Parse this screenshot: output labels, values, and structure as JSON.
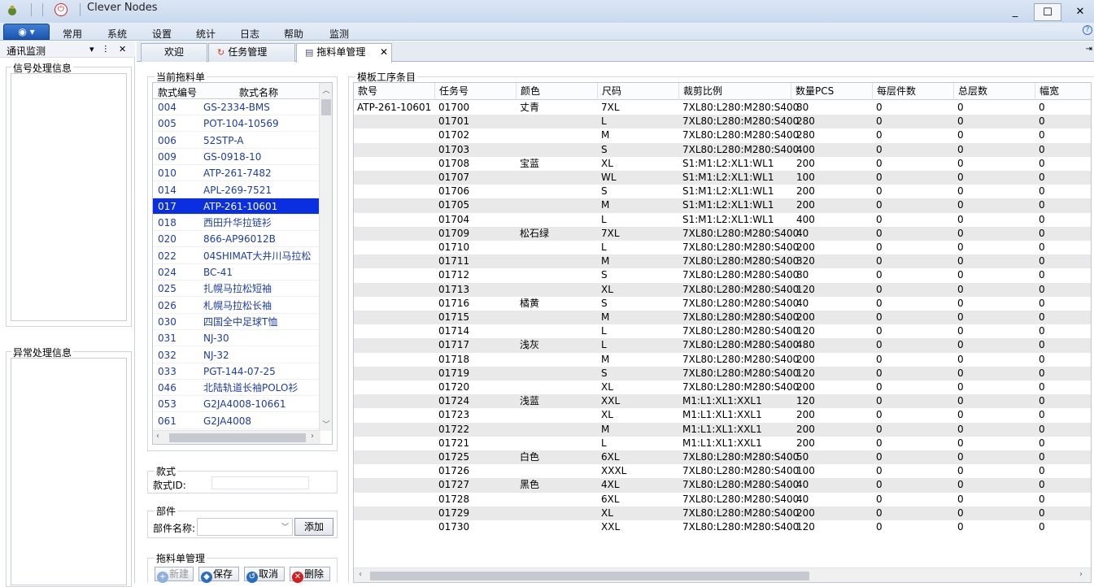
{
  "window": {
    "title": "Clever Nodes",
    "minimize": "_",
    "maximize": "☐",
    "close": "✕"
  },
  "menu": {
    "app_button": "◉ ▾",
    "items": [
      "常用",
      "系统",
      "设置",
      "统计",
      "日志",
      "帮助",
      "监测"
    ],
    "help_icon": "?"
  },
  "left_panel": {
    "title": "通讯监测",
    "pin": "▾ ⊓ ✕",
    "group1": "信号处理信息",
    "group2": "异常处理信息"
  },
  "tabs": [
    {
      "label": "欢迎",
      "icon": ""
    },
    {
      "label": "任务管理",
      "icon": "↻"
    },
    {
      "label": "拖料单管理",
      "icon": "▤",
      "close": "✕"
    }
  ],
  "current_sheet": {
    "label": "当前拖料单",
    "headers": [
      "款式编号",
      "款式名称"
    ],
    "rows": [
      [
        "004",
        "GS-2334-BMS"
      ],
      [
        "005",
        "POT-104-10569"
      ],
      [
        "006",
        "52STP-A"
      ],
      [
        "009",
        "GS-0918-10"
      ],
      [
        "010",
        "ATP-261-7482"
      ],
      [
        "014",
        "APL-269-7521"
      ],
      [
        "017",
        "ATP-261-10601"
      ],
      [
        "018",
        "西田升华拉链衫"
      ],
      [
        "020",
        "866-AP96012B"
      ],
      [
        "022",
        "04SHIMAT大井川马拉松"
      ],
      [
        "024",
        "BC-41"
      ],
      [
        "025",
        "扎幌马拉松短袖"
      ],
      [
        "026",
        "札幌马拉松长袖"
      ],
      [
        "030",
        "四国全中足球T恤"
      ],
      [
        "031",
        "NJ-30"
      ],
      [
        "032",
        "NJ-32"
      ],
      [
        "033",
        "PGT-144-07-25"
      ],
      [
        "046",
        "北陆轨道长袖POLO衫"
      ],
      [
        "053",
        "G2JA4008-10661"
      ],
      [
        "061",
        "G2JA4008"
      ]
    ],
    "selected_index": 6
  },
  "style_box": {
    "label": "款式",
    "id_label": "款式ID:",
    "id_value": ""
  },
  "part_box": {
    "label": "部件",
    "name_label": "部件名称:",
    "name_value": "",
    "add_button": "添加"
  },
  "sheet_mgmt": {
    "label": "拖料单管理",
    "new": "新建",
    "save": "保存",
    "cancel": "取消",
    "delete": "删除"
  },
  "template": {
    "label": "模板工序条目",
    "headers": [
      "款号",
      "任务号",
      "颜色",
      "尺码",
      "裁剪比例",
      "数量PCS",
      "每层件数",
      "总层数",
      "幅宽"
    ],
    "rows": [
      [
        "ATP-261-10601",
        "01700",
        "丈青",
        "7XL",
        "7XL80:L280:M280:S400",
        "80",
        "0",
        "0",
        "0"
      ],
      [
        "",
        "01701",
        "",
        "L",
        "7XL80:L280:M280:S400",
        "280",
        "0",
        "0",
        "0"
      ],
      [
        "",
        "01702",
        "",
        "M",
        "7XL80:L280:M280:S400",
        "280",
        "0",
        "0",
        "0"
      ],
      [
        "",
        "01703",
        "",
        "S",
        "7XL80:L280:M280:S400",
        "400",
        "0",
        "0",
        "0"
      ],
      [
        "",
        "01708",
        "宝蓝",
        "XL",
        "S1:M1:L2:XL1:WL1",
        "200",
        "0",
        "0",
        "0"
      ],
      [
        "",
        "01707",
        "",
        "WL",
        "S1:M1:L2:XL1:WL1",
        "100",
        "0",
        "0",
        "0"
      ],
      [
        "",
        "01706",
        "",
        "S",
        "S1:M1:L2:XL1:WL1",
        "200",
        "0",
        "0",
        "0"
      ],
      [
        "",
        "01705",
        "",
        "M",
        "S1:M1:L2:XL1:WL1",
        "200",
        "0",
        "0",
        "0"
      ],
      [
        "",
        "01704",
        "",
        "L",
        "S1:M1:L2:XL1:WL1",
        "400",
        "0",
        "0",
        "0"
      ],
      [
        "",
        "01709",
        "松石绿",
        "7XL",
        "7XL80:L280:M280:S400",
        "40",
        "0",
        "0",
        "0"
      ],
      [
        "",
        "01710",
        "",
        "L",
        "7XL80:L280:M280:S400",
        "200",
        "0",
        "0",
        "0"
      ],
      [
        "",
        "01711",
        "",
        "M",
        "7XL80:L280:M280:S400",
        "320",
        "0",
        "0",
        "0"
      ],
      [
        "",
        "01712",
        "",
        "S",
        "7XL80:L280:M280:S400",
        "80",
        "0",
        "0",
        "0"
      ],
      [
        "",
        "01713",
        "",
        "XL",
        "7XL80:L280:M280:S400",
        "120",
        "0",
        "0",
        "0"
      ],
      [
        "",
        "01716",
        "橘黄",
        "S",
        "7XL80:L280:M280:S400",
        "40",
        "0",
        "0",
        "0"
      ],
      [
        "",
        "01715",
        "",
        "M",
        "7XL80:L280:M280:S400",
        "200",
        "0",
        "0",
        "0"
      ],
      [
        "",
        "01714",
        "",
        "L",
        "7XL80:L280:M280:S400",
        "120",
        "0",
        "0",
        "0"
      ],
      [
        "",
        "01717",
        "浅灰",
        "L",
        "7XL80:L280:M280:S400",
        "480",
        "0",
        "0",
        "0"
      ],
      [
        "",
        "01718",
        "",
        "M",
        "7XL80:L280:M280:S400",
        "200",
        "0",
        "0",
        "0"
      ],
      [
        "",
        "01719",
        "",
        "S",
        "7XL80:L280:M280:S400",
        "120",
        "0",
        "0",
        "0"
      ],
      [
        "",
        "01720",
        "",
        "XL",
        "7XL80:L280:M280:S400",
        "200",
        "0",
        "0",
        "0"
      ],
      [
        "",
        "01724",
        "浅蓝",
        "XXL",
        "M1:L1:XL1:XXL1",
        "120",
        "0",
        "0",
        "0"
      ],
      [
        "",
        "01723",
        "",
        "XL",
        "M1:L1:XL1:XXL1",
        "200",
        "0",
        "0",
        "0"
      ],
      [
        "",
        "01722",
        "",
        "M",
        "M1:L1:XL1:XXL1",
        "200",
        "0",
        "0",
        "0"
      ],
      [
        "",
        "01721",
        "",
        "L",
        "M1:L1:XL1:XXL1",
        "200",
        "0",
        "0",
        "0"
      ],
      [
        "",
        "01725",
        "白色",
        "6XL",
        "7XL80:L280:M280:S400",
        "50",
        "0",
        "0",
        "0"
      ],
      [
        "",
        "01726",
        "",
        "XXXL",
        "7XL80:L280:M280:S400",
        "100",
        "0",
        "0",
        "0"
      ],
      [
        "",
        "01727",
        "黑色",
        "4XL",
        "7XL80:L280:M280:S400",
        "40",
        "0",
        "0",
        "0"
      ],
      [
        "",
        "01728",
        "",
        "6XL",
        "7XL80:L280:M280:S400",
        "40",
        "0",
        "0",
        "0"
      ],
      [
        "",
        "01729",
        "",
        "XL",
        "7XL80:L280:M280:S400",
        "200",
        "0",
        "0",
        "0"
      ],
      [
        "",
        "01730",
        "",
        "XXL",
        "7XL80:L280:M280:S400",
        "120",
        "0",
        "0",
        "0"
      ]
    ]
  }
}
